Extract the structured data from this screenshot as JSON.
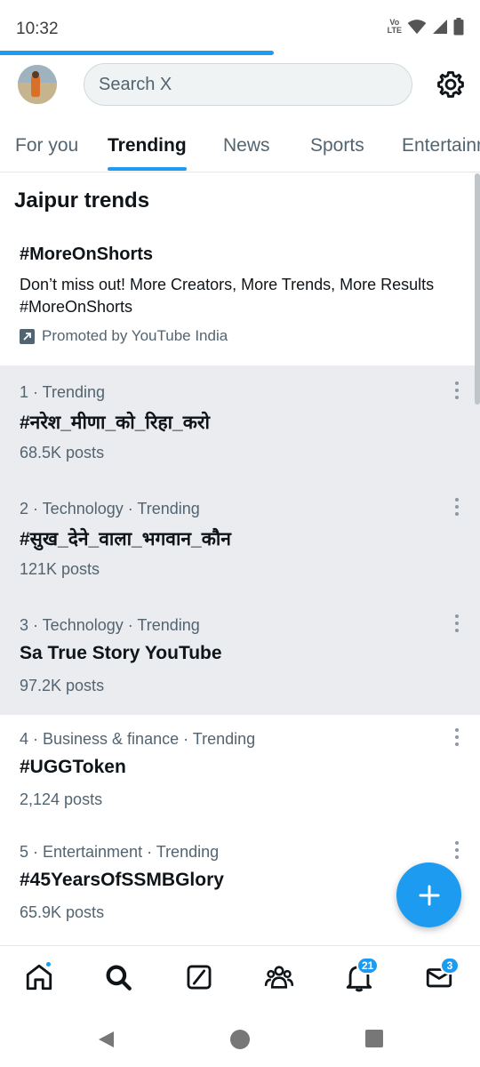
{
  "status_bar": {
    "time": "10:32",
    "volte_top": "Vo",
    "volte_bottom": "LTE",
    "load_progress": 0.57,
    "icons": [
      "wifi-icon",
      "signal-icon",
      "battery-icon"
    ]
  },
  "header": {
    "avatar": "profile-avatar",
    "search_placeholder": "Search X",
    "settings_icon": "gear-icon"
  },
  "tabs": [
    {
      "label": "For you",
      "active": false
    },
    {
      "label": "Trending",
      "active": true
    },
    {
      "label": "News",
      "active": false
    },
    {
      "label": "Sports",
      "active": false
    },
    {
      "label": "Entertainment",
      "active": false
    }
  ],
  "section_title": "Jaipur trends",
  "promoted": {
    "title": "#MoreOnShorts",
    "description": "Don’t miss out! More Creators, More Trends, More Results #MoreOnShorts",
    "promoted_by": "Promoted by YouTube India"
  },
  "trends": [
    {
      "meta": "1 · Trending",
      "name": "#नरेश_मीणा_को_रिहा_करो",
      "posts": "68.5K posts",
      "shaded": true
    },
    {
      "meta": "2 · Technology · Trending",
      "name": "#सुख_देने_वाला_भगवान_कौन",
      "posts": "121K posts",
      "shaded": true
    },
    {
      "meta": "3 · Technology · Trending",
      "name": "Sa True Story YouTube",
      "posts": "97.2K posts",
      "shaded": true
    },
    {
      "meta": "4 · Business & finance · Trending",
      "name": "#UGGToken",
      "posts": "2,124 posts",
      "shaded": false
    },
    {
      "meta": "5 · Entertainment · Trending",
      "name": "#45YearsOfSSMBGlory",
      "posts": "65.9K posts",
      "shaded": false
    }
  ],
  "fab": {
    "icon": "plus-icon"
  },
  "bottom_nav": {
    "home": {
      "icon": "home-icon",
      "has_dot": true
    },
    "search": {
      "icon": "search-icon"
    },
    "grok": {
      "icon": "grok-icon"
    },
    "communities": {
      "icon": "communities-icon"
    },
    "notifications": {
      "icon": "bell-icon",
      "badge": "21"
    },
    "messages": {
      "icon": "mail-icon",
      "badge": "3"
    }
  },
  "colors": {
    "accent": "#1d9bf0",
    "text_primary": "#0f1419",
    "text_secondary": "#536471",
    "highlight_bg": "#eaecef"
  }
}
